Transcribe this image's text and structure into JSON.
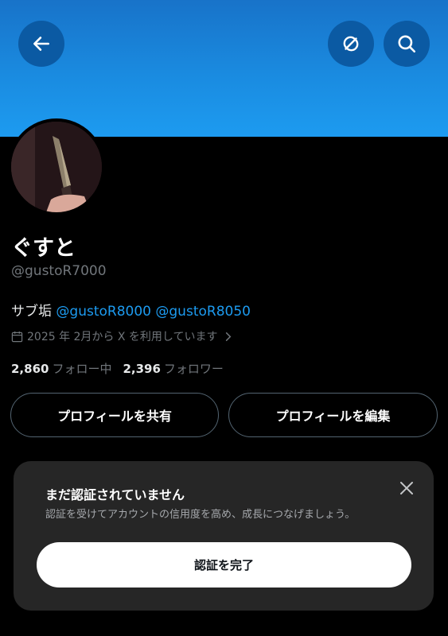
{
  "header": {
    "back_icon": "arrow-left-icon",
    "unlink_icon": "circle-slash-icon",
    "search_icon": "search-icon",
    "banner_color": "#1d9bf0"
  },
  "profile": {
    "name": "ぐすと",
    "handle": "@gustoR7000",
    "bio_text": "サブ垢",
    "bio_mentions": [
      "@gustoR8000",
      "@gustoR8050"
    ],
    "joined": "2025 年 2月から X を利用しています",
    "following_count": "2,860",
    "following_label": "フォロー中",
    "followers_count": "2,396",
    "followers_label": "フォロワー"
  },
  "actions": {
    "share_label": "プロフィールを共有",
    "edit_label": "プロフィールを編集"
  },
  "verify_card": {
    "title": "まだ認証されていません",
    "subtitle": "認証を受けてアカウントの信用度を高め、成長につなげましょう。",
    "button_label": "認証を完了"
  }
}
